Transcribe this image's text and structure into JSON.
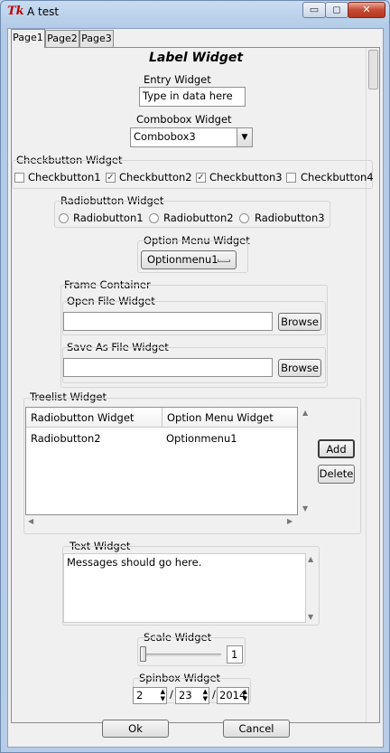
{
  "window": {
    "title": "A test",
    "app_icon": "Tk",
    "buttons": {
      "minimize": "▭",
      "maximize": "◻",
      "close": "✕"
    }
  },
  "tabs": [
    {
      "label": "Page1",
      "selected": true
    },
    {
      "label": "Page2",
      "selected": false
    },
    {
      "label": "Page3",
      "selected": false
    }
  ],
  "page1": {
    "heading": "Label Widget",
    "entry": {
      "label": "Entry Widget",
      "value": "Type in data here"
    },
    "combobox": {
      "label": "Combobox Widget",
      "value": "Combobox3"
    },
    "checkbuttons": {
      "label": "Checkbutton Widget",
      "items": [
        {
          "label": "Checkbutton1",
          "checked": false,
          "mark": ""
        },
        {
          "label": "Checkbutton2",
          "checked": true,
          "mark": "✓"
        },
        {
          "label": "Checkbutton3",
          "checked": true,
          "mark": "✓"
        },
        {
          "label": "Checkbutton4",
          "checked": false,
          "mark": ""
        }
      ]
    },
    "radiobuttons": {
      "label": "Radiobutton Widget",
      "items": [
        "Radiobutton1",
        "Radiobutton2",
        "Radiobutton3"
      ]
    },
    "option_menu": {
      "label": "Option Menu Widget",
      "value": "Optionmenu1"
    },
    "frame": {
      "label": "Frame Container",
      "open_file": {
        "label": "Open File Widget",
        "value": "",
        "button": "Browse"
      },
      "save_file": {
        "label": "Save As File Widget",
        "value": "",
        "button": "Browse"
      }
    },
    "treelist": {
      "label": "Treelist Widget",
      "columns": [
        "Radiobutton Widget",
        "Option Menu Widget"
      ],
      "rows": [
        [
          "Radiobutton2",
          "Optionmenu1"
        ]
      ],
      "add_button": "Add",
      "delete_button": "Delete"
    },
    "text": {
      "label": "Text Widget",
      "value": "Messages should go here."
    },
    "scale": {
      "label": "Scale Widget",
      "value": "1"
    },
    "spinbox": {
      "label": "Spinbox Widget",
      "values": [
        "2",
        "23",
        "2014"
      ],
      "separators": [
        "/",
        "/"
      ]
    }
  },
  "footer": {
    "ok": "Ok",
    "cancel": "Cancel"
  }
}
